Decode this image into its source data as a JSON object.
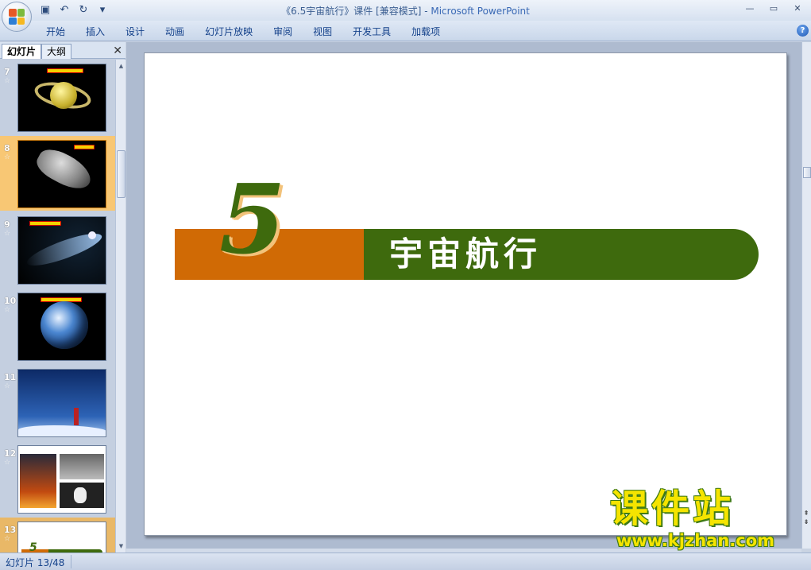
{
  "window": {
    "title_prefix": "《6.5宇宙航行》课件 [兼容模式] - ",
    "title_app": "Microsoft PowerPoint"
  },
  "ribbon": {
    "tabs": [
      "开始",
      "插入",
      "设计",
      "动画",
      "幻灯片放映",
      "审阅",
      "视图",
      "开发工具",
      "加载项"
    ]
  },
  "left_pane": {
    "tab_slides": "幻灯片",
    "tab_outline": "大纲",
    "thumbnails": [
      {
        "number": "7",
        "scene": "saturn"
      },
      {
        "number": "8",
        "scene": "asteroid",
        "selected": true
      },
      {
        "number": "9",
        "scene": "comet"
      },
      {
        "number": "10",
        "scene": "earth"
      },
      {
        "number": "11",
        "scene": "night-sky"
      },
      {
        "number": "12",
        "scene": "rocket-collage"
      },
      {
        "number": "13",
        "scene": "title-slide",
        "current": true
      }
    ]
  },
  "slide": {
    "number_label": "5",
    "title": "宇宙航行",
    "colors": {
      "orange": "#d06a05",
      "green": "#3e6a0d"
    }
  },
  "status": {
    "slide_indicator": "幻灯片 13/48"
  },
  "watermark": {
    "main": "课件站",
    "url": "www.kjzhan.com"
  }
}
